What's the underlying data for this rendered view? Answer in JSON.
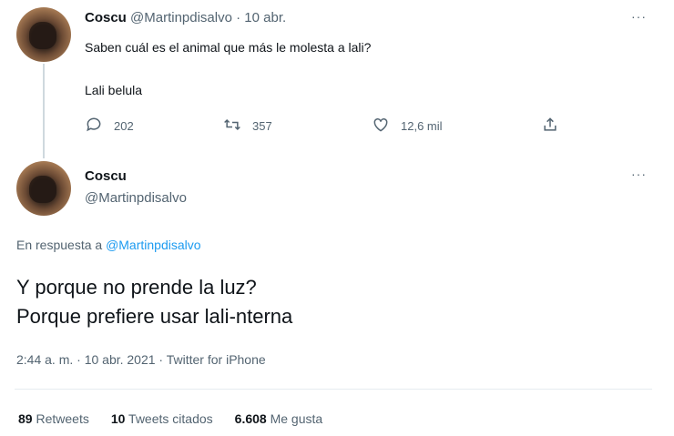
{
  "first_tweet": {
    "display_name": "Coscu",
    "handle": "@Martinpdisalvo",
    "separator": "·",
    "date": "10 abr.",
    "text_line1": "Saben cuál es el animal que más le molesta a lali?",
    "text_line2": "Lali belula",
    "replies": "202",
    "retweets": "357",
    "likes": "12,6 mil",
    "icons": [
      "reply-icon",
      "retweet-icon",
      "like-icon",
      "share-icon"
    ]
  },
  "main_tweet": {
    "display_name": "Coscu",
    "handle": "@Martinpdisalvo",
    "reply_prefix": "En respuesta a",
    "reply_to": "@Martinpdisalvo",
    "text_line1": "Y porque no prende la luz?",
    "text_line2": "Porque prefiere usar lali-nterna",
    "meta": "2:44 a. m. · 10 abr. 2021 · Twitter for iPhone",
    "stats": {
      "retweets_count": "89",
      "retweets_label": "Retweets",
      "quotes_count": "10",
      "quotes_label": "Tweets citados",
      "likes_count": "6.608",
      "likes_label": "Me gusta"
    }
  },
  "more_label": "···",
  "colors": {
    "link": "#1d9bf0",
    "muted": "#536471",
    "text": "#0f1419"
  }
}
